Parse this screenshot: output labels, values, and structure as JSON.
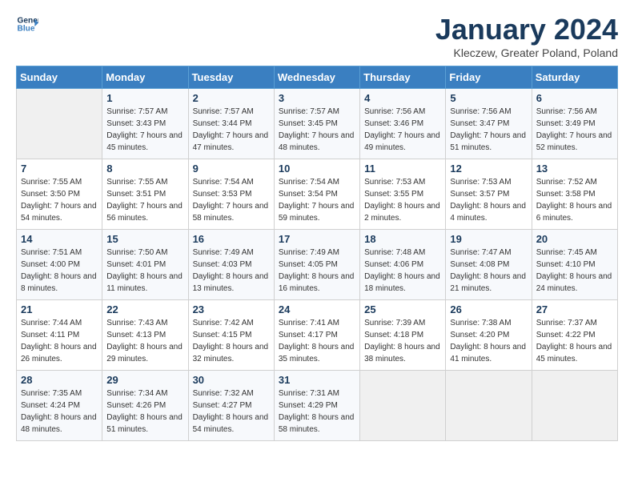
{
  "header": {
    "logo_line1": "General",
    "logo_line2": "Blue",
    "month_title": "January 2024",
    "subtitle": "Kleczew, Greater Poland, Poland"
  },
  "days_of_week": [
    "Sunday",
    "Monday",
    "Tuesday",
    "Wednesday",
    "Thursday",
    "Friday",
    "Saturday"
  ],
  "weeks": [
    [
      {
        "day": "",
        "sunrise": "",
        "sunset": "",
        "daylight": ""
      },
      {
        "day": "1",
        "sunrise": "Sunrise: 7:57 AM",
        "sunset": "Sunset: 3:43 PM",
        "daylight": "Daylight: 7 hours and 45 minutes."
      },
      {
        "day": "2",
        "sunrise": "Sunrise: 7:57 AM",
        "sunset": "Sunset: 3:44 PM",
        "daylight": "Daylight: 7 hours and 47 minutes."
      },
      {
        "day": "3",
        "sunrise": "Sunrise: 7:57 AM",
        "sunset": "Sunset: 3:45 PM",
        "daylight": "Daylight: 7 hours and 48 minutes."
      },
      {
        "day": "4",
        "sunrise": "Sunrise: 7:56 AM",
        "sunset": "Sunset: 3:46 PM",
        "daylight": "Daylight: 7 hours and 49 minutes."
      },
      {
        "day": "5",
        "sunrise": "Sunrise: 7:56 AM",
        "sunset": "Sunset: 3:47 PM",
        "daylight": "Daylight: 7 hours and 51 minutes."
      },
      {
        "day": "6",
        "sunrise": "Sunrise: 7:56 AM",
        "sunset": "Sunset: 3:49 PM",
        "daylight": "Daylight: 7 hours and 52 minutes."
      }
    ],
    [
      {
        "day": "7",
        "sunrise": "Sunrise: 7:55 AM",
        "sunset": "Sunset: 3:50 PM",
        "daylight": "Daylight: 7 hours and 54 minutes."
      },
      {
        "day": "8",
        "sunrise": "Sunrise: 7:55 AM",
        "sunset": "Sunset: 3:51 PM",
        "daylight": "Daylight: 7 hours and 56 minutes."
      },
      {
        "day": "9",
        "sunrise": "Sunrise: 7:54 AM",
        "sunset": "Sunset: 3:53 PM",
        "daylight": "Daylight: 7 hours and 58 minutes."
      },
      {
        "day": "10",
        "sunrise": "Sunrise: 7:54 AM",
        "sunset": "Sunset: 3:54 PM",
        "daylight": "Daylight: 7 hours and 59 minutes."
      },
      {
        "day": "11",
        "sunrise": "Sunrise: 7:53 AM",
        "sunset": "Sunset: 3:55 PM",
        "daylight": "Daylight: 8 hours and 2 minutes."
      },
      {
        "day": "12",
        "sunrise": "Sunrise: 7:53 AM",
        "sunset": "Sunset: 3:57 PM",
        "daylight": "Daylight: 8 hours and 4 minutes."
      },
      {
        "day": "13",
        "sunrise": "Sunrise: 7:52 AM",
        "sunset": "Sunset: 3:58 PM",
        "daylight": "Daylight: 8 hours and 6 minutes."
      }
    ],
    [
      {
        "day": "14",
        "sunrise": "Sunrise: 7:51 AM",
        "sunset": "Sunset: 4:00 PM",
        "daylight": "Daylight: 8 hours and 8 minutes."
      },
      {
        "day": "15",
        "sunrise": "Sunrise: 7:50 AM",
        "sunset": "Sunset: 4:01 PM",
        "daylight": "Daylight: 8 hours and 11 minutes."
      },
      {
        "day": "16",
        "sunrise": "Sunrise: 7:49 AM",
        "sunset": "Sunset: 4:03 PM",
        "daylight": "Daylight: 8 hours and 13 minutes."
      },
      {
        "day": "17",
        "sunrise": "Sunrise: 7:49 AM",
        "sunset": "Sunset: 4:05 PM",
        "daylight": "Daylight: 8 hours and 16 minutes."
      },
      {
        "day": "18",
        "sunrise": "Sunrise: 7:48 AM",
        "sunset": "Sunset: 4:06 PM",
        "daylight": "Daylight: 8 hours and 18 minutes."
      },
      {
        "day": "19",
        "sunrise": "Sunrise: 7:47 AM",
        "sunset": "Sunset: 4:08 PM",
        "daylight": "Daylight: 8 hours and 21 minutes."
      },
      {
        "day": "20",
        "sunrise": "Sunrise: 7:45 AM",
        "sunset": "Sunset: 4:10 PM",
        "daylight": "Daylight: 8 hours and 24 minutes."
      }
    ],
    [
      {
        "day": "21",
        "sunrise": "Sunrise: 7:44 AM",
        "sunset": "Sunset: 4:11 PM",
        "daylight": "Daylight: 8 hours and 26 minutes."
      },
      {
        "day": "22",
        "sunrise": "Sunrise: 7:43 AM",
        "sunset": "Sunset: 4:13 PM",
        "daylight": "Daylight: 8 hours and 29 minutes."
      },
      {
        "day": "23",
        "sunrise": "Sunrise: 7:42 AM",
        "sunset": "Sunset: 4:15 PM",
        "daylight": "Daylight: 8 hours and 32 minutes."
      },
      {
        "day": "24",
        "sunrise": "Sunrise: 7:41 AM",
        "sunset": "Sunset: 4:17 PM",
        "daylight": "Daylight: 8 hours and 35 minutes."
      },
      {
        "day": "25",
        "sunrise": "Sunrise: 7:39 AM",
        "sunset": "Sunset: 4:18 PM",
        "daylight": "Daylight: 8 hours and 38 minutes."
      },
      {
        "day": "26",
        "sunrise": "Sunrise: 7:38 AM",
        "sunset": "Sunset: 4:20 PM",
        "daylight": "Daylight: 8 hours and 41 minutes."
      },
      {
        "day": "27",
        "sunrise": "Sunrise: 7:37 AM",
        "sunset": "Sunset: 4:22 PM",
        "daylight": "Daylight: 8 hours and 45 minutes."
      }
    ],
    [
      {
        "day": "28",
        "sunrise": "Sunrise: 7:35 AM",
        "sunset": "Sunset: 4:24 PM",
        "daylight": "Daylight: 8 hours and 48 minutes."
      },
      {
        "day": "29",
        "sunrise": "Sunrise: 7:34 AM",
        "sunset": "Sunset: 4:26 PM",
        "daylight": "Daylight: 8 hours and 51 minutes."
      },
      {
        "day": "30",
        "sunrise": "Sunrise: 7:32 AM",
        "sunset": "Sunset: 4:27 PM",
        "daylight": "Daylight: 8 hours and 54 minutes."
      },
      {
        "day": "31",
        "sunrise": "Sunrise: 7:31 AM",
        "sunset": "Sunset: 4:29 PM",
        "daylight": "Daylight: 8 hours and 58 minutes."
      },
      {
        "day": "",
        "sunrise": "",
        "sunset": "",
        "daylight": ""
      },
      {
        "day": "",
        "sunrise": "",
        "sunset": "",
        "daylight": ""
      },
      {
        "day": "",
        "sunrise": "",
        "sunset": "",
        "daylight": ""
      }
    ]
  ]
}
